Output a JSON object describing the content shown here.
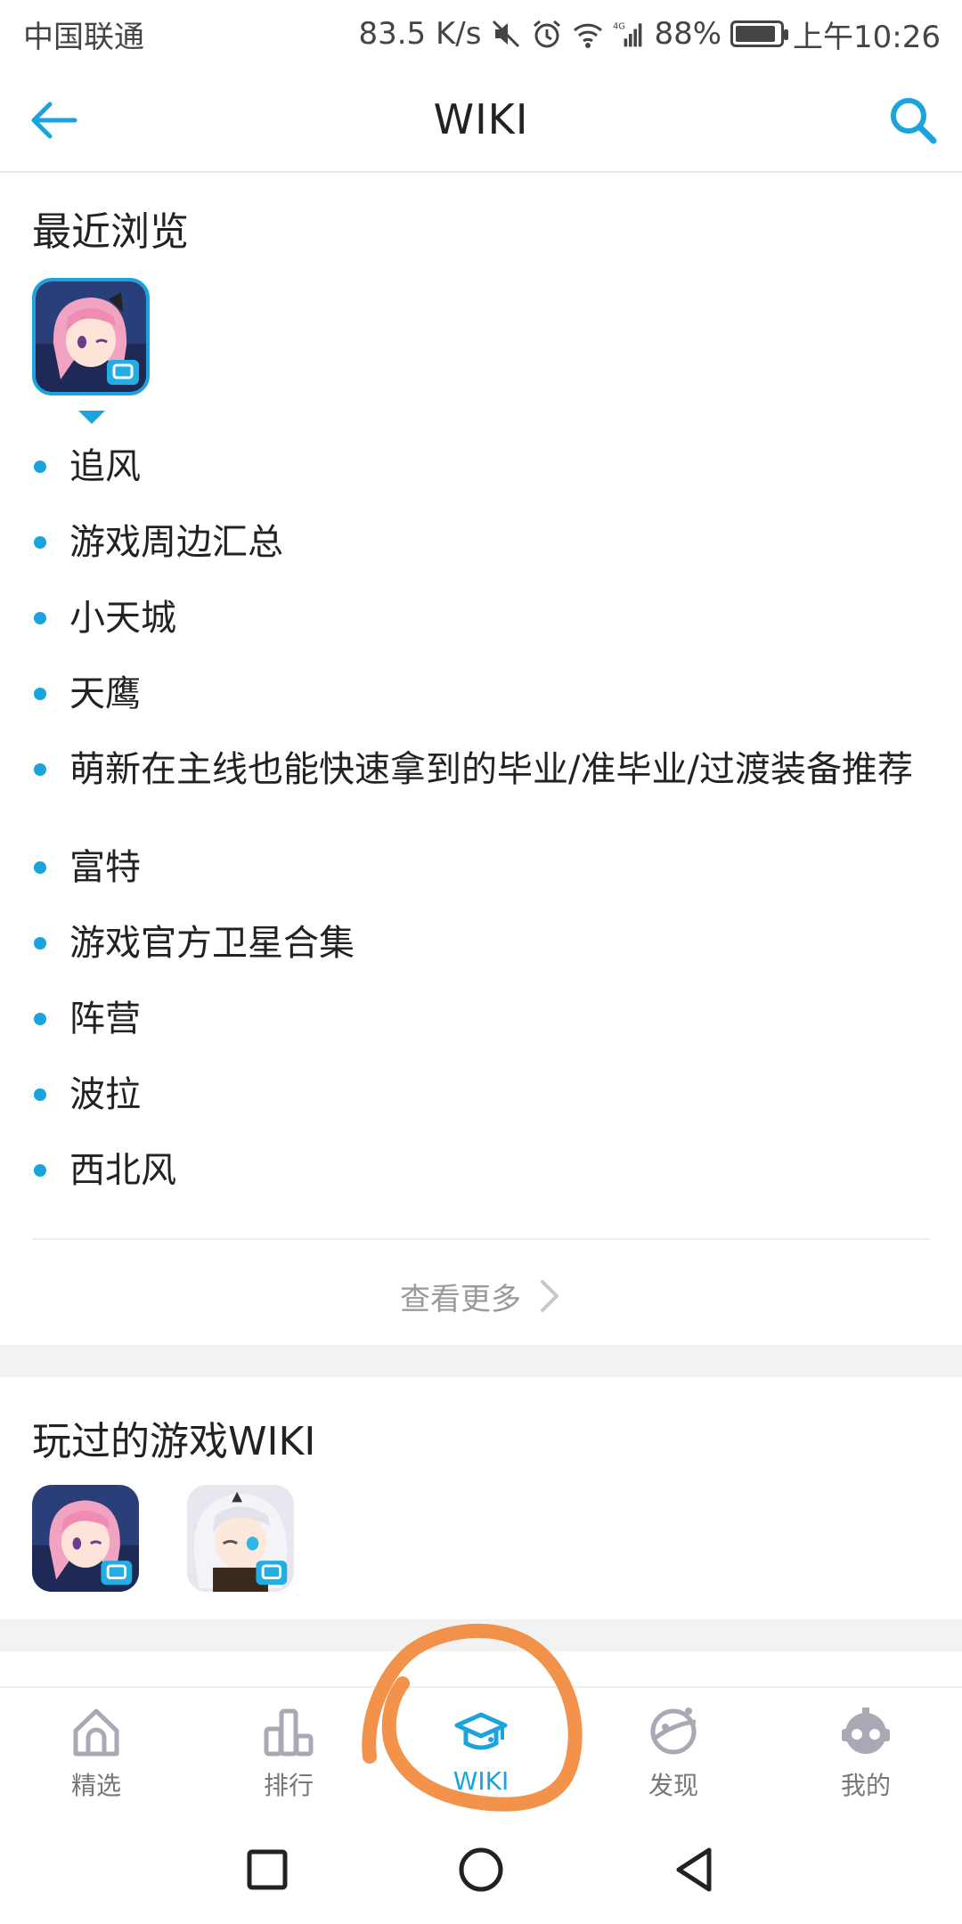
{
  "status_bar": {
    "carrier": "中国联通",
    "speed": "83.5 K/s",
    "network": "4G",
    "battery": "88%",
    "battery_level": 0.88,
    "time": "上午10:26"
  },
  "header": {
    "title": "WIKI"
  },
  "recent": {
    "title": "最近浏览",
    "items": [
      "追风",
      "游戏周边汇总",
      "小天城",
      "天鹰",
      "萌新在主线也能快速拿到的毕业/准毕业/过渡装备推荐",
      "富特",
      "游戏官方卫星合集",
      "阵营",
      "波拉",
      "西北风"
    ],
    "more_label": "查看更多"
  },
  "played": {
    "title": "玩过的游戏WIKI"
  },
  "bottom_nav": {
    "items": [
      {
        "label": "精选",
        "icon": "home-icon"
      },
      {
        "label": "排行",
        "icon": "ranking-icon"
      },
      {
        "label": "WIKI",
        "icon": "graduation-cap-icon"
      },
      {
        "label": "发现",
        "icon": "planet-icon"
      },
      {
        "label": "我的",
        "icon": "mascot-icon"
      }
    ]
  },
  "colors": {
    "accent": "#1aa3dd",
    "annotation": "#f28a3c"
  }
}
